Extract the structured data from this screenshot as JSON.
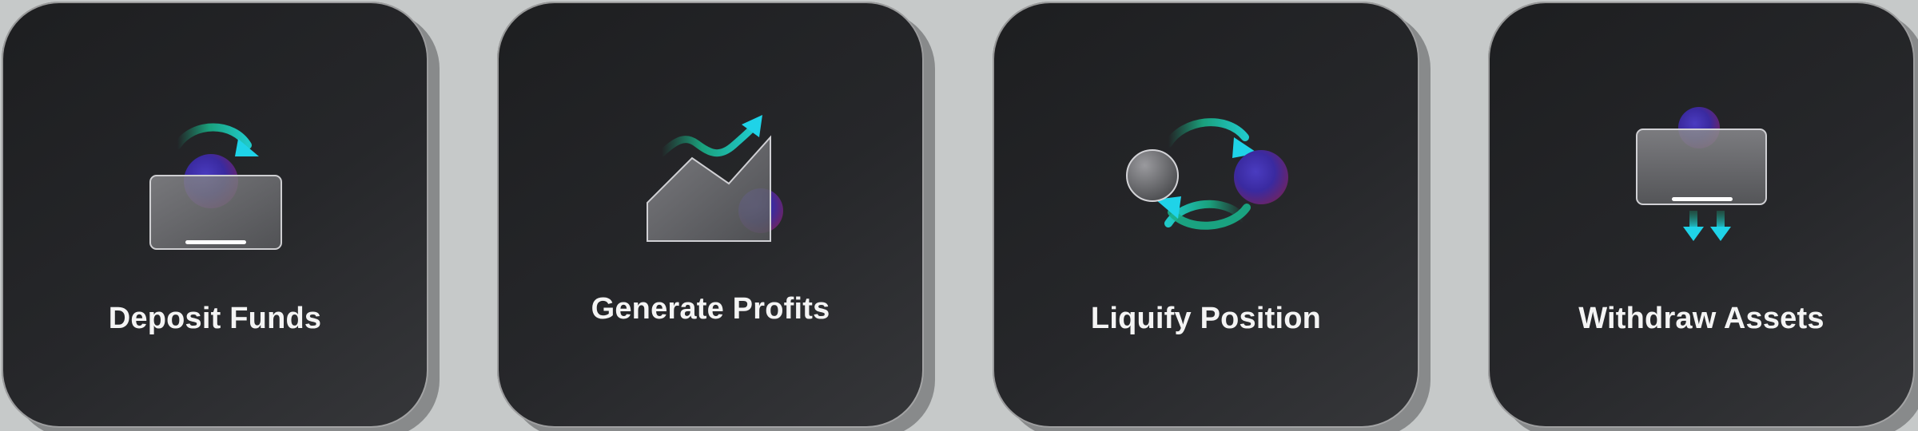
{
  "cards": [
    {
      "label": "Deposit Funds",
      "icon": "deposit-icon"
    },
    {
      "label": "Generate Profits",
      "icon": "profit-chart-icon"
    },
    {
      "label": "Liquify Position",
      "icon": "swap-cycle-icon"
    },
    {
      "label": "Withdraw Assets",
      "icon": "withdraw-icon"
    }
  ],
  "colors": {
    "card_background": "#1d1e20",
    "accent_cyan": "#1fd3e8",
    "accent_green": "#1a9a74",
    "orb_purple": "#5a2fa0",
    "page_background": "#c6c9c9"
  }
}
